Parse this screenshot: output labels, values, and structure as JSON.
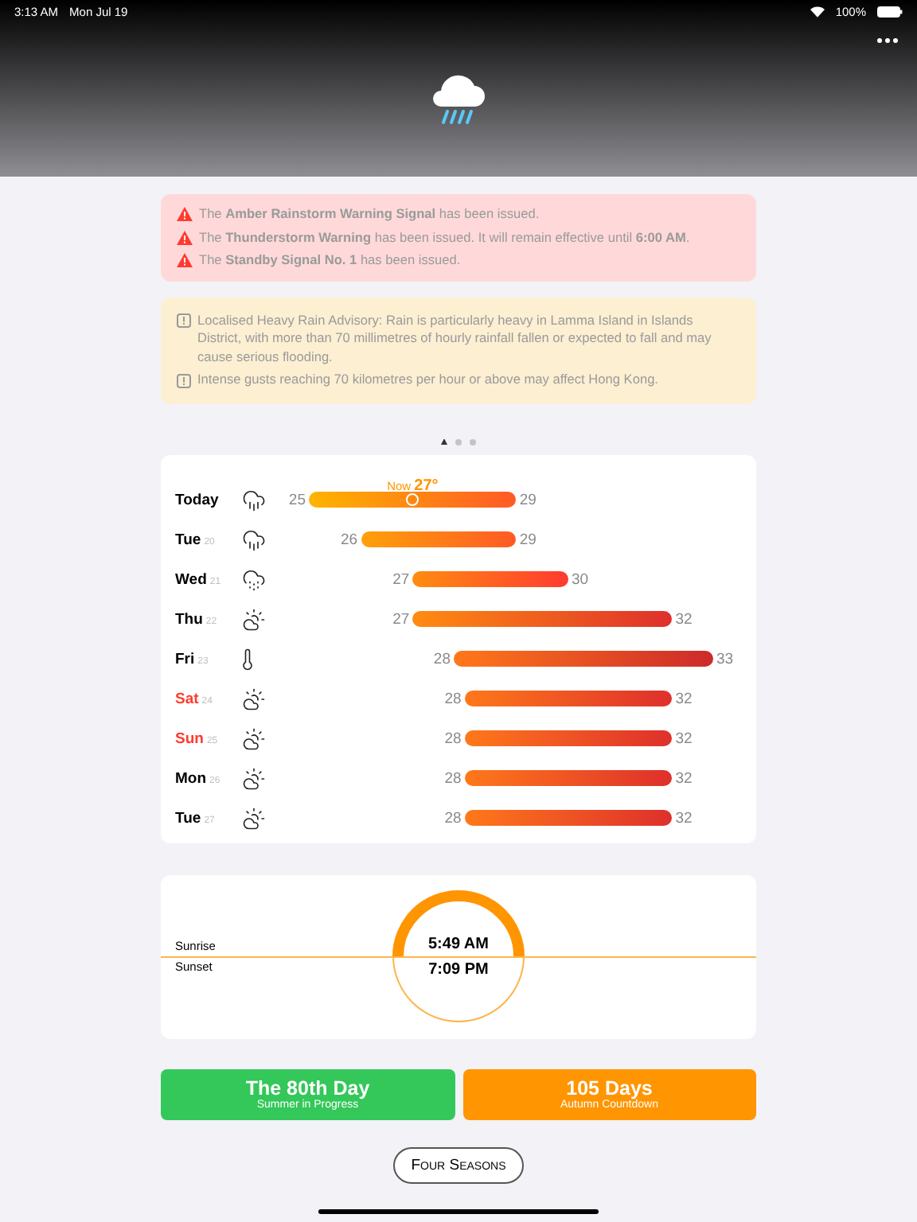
{
  "status_bar": {
    "time": "3:13 AM",
    "date": "Mon Jul 19",
    "battery": "100%"
  },
  "alerts": [
    {
      "text": "The **Amber Rainstorm Warning Signal** has been issued."
    },
    {
      "text": "The **Thunderstorm Warning** has been issued. It will remain effective until **6:00 AM**."
    },
    {
      "text": "The **Standby Signal No. 1** has been issued."
    }
  ],
  "advisories": [
    {
      "text": "Localised Heavy Rain Advisory: Rain is particularly heavy in Lamma Island in Islands District, with more than 70 millimetres of hourly rainfall fallen or expected to fall and may cause serious flooding."
    },
    {
      "text": "Intense gusts reaching 70 kilometres per hour or above may affect Hong Kong."
    }
  ],
  "pager": [
    {
      "kind": "location",
      "selected": true
    },
    {
      "kind": "dot",
      "selected": false
    },
    {
      "kind": "dot",
      "selected": false
    }
  ],
  "forecast": {
    "now_label": "Now",
    "now_temp": "27°",
    "days": [
      {
        "day": "Today",
        "weekend": false,
        "kind": "rain",
        "low": "25",
        "high": "29",
        "now": true
      },
      {
        "day": "Tue",
        "date": "20",
        "weekend": false,
        "kind": "rain",
        "low": "26",
        "high": "29",
        "now": false
      },
      {
        "day": "Wed",
        "date": "21",
        "weekend": false,
        "kind": "showers",
        "low": "27",
        "high": "30",
        "now": false
      },
      {
        "day": "Thu",
        "date": "22",
        "weekend": false,
        "kind": "sun-cloud",
        "low": "27",
        "high": "32",
        "now": false
      },
      {
        "day": "Fri",
        "date": "23",
        "weekend": false,
        "kind": "hot",
        "low": "28",
        "high": "33",
        "now": false
      },
      {
        "day": "Sat",
        "date": "24",
        "weekend": true,
        "kind": "sun-cloud",
        "low": "28",
        "high": "32",
        "now": false
      },
      {
        "day": "Sun",
        "date": "25",
        "weekend": true,
        "kind": "sun-cloud",
        "low": "28",
        "high": "32",
        "now": false
      },
      {
        "day": "Mon",
        "date": "26",
        "weekend": false,
        "kind": "sun-cloud",
        "low": "28",
        "high": "32",
        "now": false
      },
      {
        "day": "Tue",
        "date": "27",
        "weekend": false,
        "kind": "sun-cloud",
        "low": "28",
        "high": "32",
        "now": false
      }
    ]
  },
  "sun": {
    "sunrise_label": "Sunrise",
    "sunset_label": "Sunset",
    "sunrise": "5:49 AM",
    "sunset": "7:09 PM"
  },
  "seasons": [
    {
      "color": "#34c759",
      "title": "The 80th Day",
      "subtitle": "Summer in Progress"
    },
    {
      "color": "#ff9500",
      "title": "105 Days",
      "subtitle": "Autumn Countdown"
    }
  ],
  "button": "Four Seasons"
}
